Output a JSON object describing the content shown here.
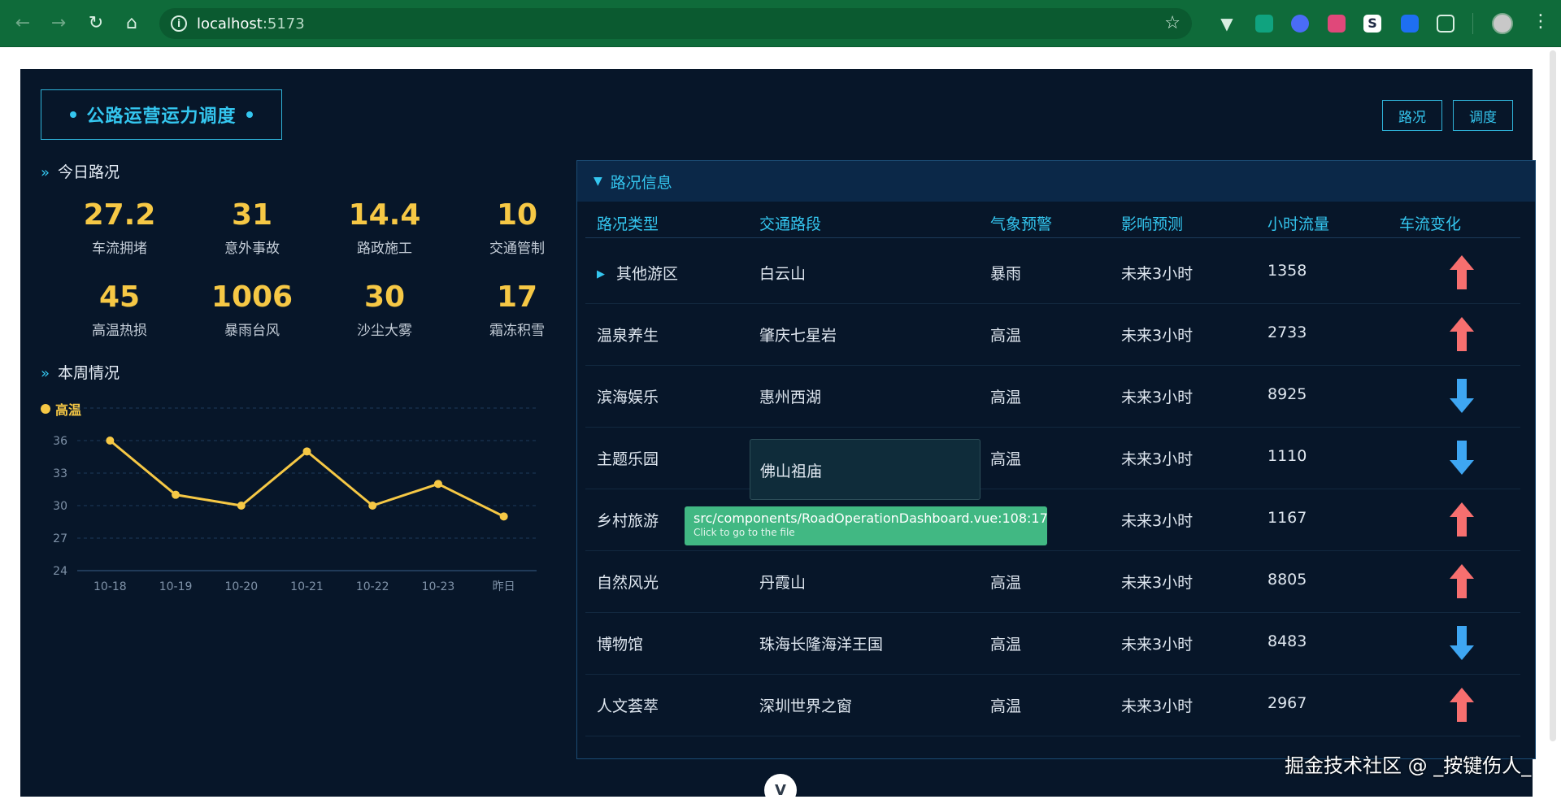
{
  "browser": {
    "url_host": "localhost",
    "url_port": ":5173"
  },
  "dashboard": {
    "title": "公路运营运力调度",
    "buttons": [
      "路况",
      "调度"
    ],
    "today": {
      "heading": "今日路况",
      "stats": [
        {
          "value": "27.2",
          "label": "车流拥堵"
        },
        {
          "value": "31",
          "label": "意外事故"
        },
        {
          "value": "14.4",
          "label": "路政施工"
        },
        {
          "value": "10",
          "label": "交通管制"
        },
        {
          "value": "45",
          "label": "高温热损"
        },
        {
          "value": "1006",
          "label": "暴雨台风"
        },
        {
          "value": "30",
          "label": "沙尘大雾"
        },
        {
          "value": "17",
          "label": "霜冻积雪"
        }
      ]
    },
    "week": {
      "heading": "本周情况"
    }
  },
  "chart_data": {
    "type": "line",
    "categories": [
      "10-18",
      "10-19",
      "10-20",
      "10-21",
      "10-22",
      "10-23",
      "昨日"
    ],
    "series": [
      {
        "name": "高温",
        "values": [
          36,
          31,
          30,
          35,
          30,
          32,
          29
        ]
      }
    ],
    "y_ticks": [
      "24",
      "27",
      "30",
      "33",
      "36"
    ],
    "ylim": [
      24,
      39
    ],
    "grid": true,
    "legend": "top-left",
    "line_color": "#f6c845"
  },
  "panel": {
    "title": "路况信息",
    "columns": [
      "路况类型",
      "交通路段",
      "气象预警",
      "影响预测",
      "小时流量",
      "车流变化"
    ],
    "rows": [
      {
        "type": "其他游区",
        "section": "白云山",
        "warning": "暴雨",
        "forecast": "未来3小时",
        "flow": "1358",
        "trend": "up",
        "expandable": true
      },
      {
        "type": "温泉养生",
        "section": "肇庆七星岩",
        "warning": "高温",
        "forecast": "未来3小时",
        "flow": "2733",
        "trend": "up"
      },
      {
        "type": "滨海娱乐",
        "section": "惠州西湖",
        "warning": "高温",
        "forecast": "未来3小时",
        "flow": "8925",
        "trend": "down"
      },
      {
        "type": "主题乐园",
        "section": "佛山祖庙",
        "warning": "高温",
        "forecast": "未来3小时",
        "flow": "1110",
        "trend": "down"
      },
      {
        "type": "乡村旅游",
        "section": "",
        "warning": "",
        "forecast": "未来3小时",
        "flow": "1167",
        "trend": "up"
      },
      {
        "type": "自然风光",
        "section": "丹霞山",
        "warning": "高温",
        "forecast": "未来3小时",
        "flow": "8805",
        "trend": "up"
      },
      {
        "type": "博物馆",
        "section": "珠海长隆海洋王国",
        "warning": "高温",
        "forecast": "未来3小时",
        "flow": "8483",
        "trend": "down"
      },
      {
        "type": "人文荟萃",
        "section": "深圳世界之窗",
        "warning": "高温",
        "forecast": "未来3小时",
        "flow": "2967",
        "trend": "up"
      }
    ],
    "colors": {
      "up": "#f76f6f",
      "down": "#3ea6f2"
    }
  },
  "tooltip": {
    "path": "src/components/RoadOperationDashboard.vue:108:17",
    "hint": "Click to go to the file"
  },
  "watermark": "掘金技术社区 @ _按键伤人_",
  "icons": {
    "back": "arrow-left-icon",
    "forward": "arrow-right-icon",
    "reload": "reload-icon",
    "home": "home-icon",
    "star": "star-icon",
    "extensions": "puzzle-icon"
  }
}
